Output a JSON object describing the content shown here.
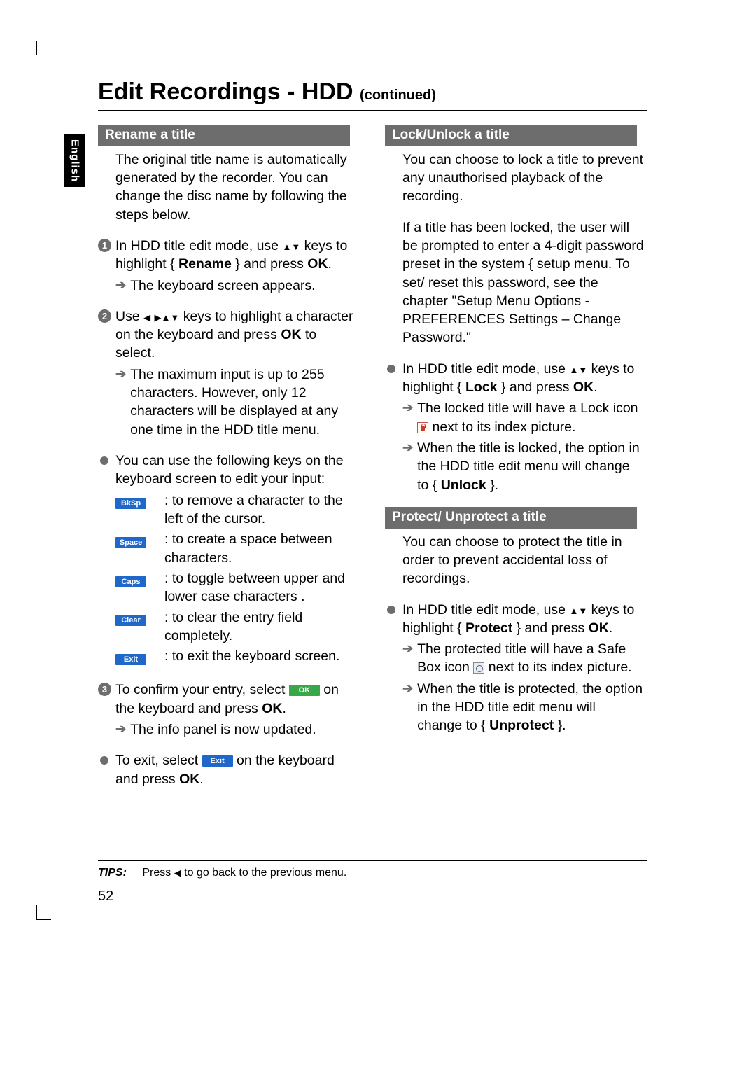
{
  "side_tab": "English",
  "title_main": "Edit Recordings - HDD",
  "title_cont": "(continued)",
  "left": {
    "section": "Rename a title",
    "intro": "The original title name is automatically generated by the recorder. You can change the disc name by following the steps below.",
    "step1_a": "In HDD title edit mode, use ",
    "step1_b": " keys to highlight { ",
    "step1_bold": "Rename",
    "step1_c": " } and press ",
    "step1_ok": "OK",
    "step1_d": ".",
    "step1_res": "The keyboard screen appears.",
    "step2_a": "Use ",
    "step2_b": " keys to highlight a character on the keyboard and press ",
    "step2_ok": "OK",
    "step2_c": " to select.",
    "step2_res": "The maximum input is up to 255 characters. However, only 12 characters will be displayed at any one time in the HDD title menu.",
    "bullet_use": "You can use the following keys on the keyboard screen to edit your input:",
    "keys": [
      {
        "cap": "BkSp",
        "desc": ": to remove a character to the left of the cursor."
      },
      {
        "cap": "Space",
        "desc": ": to create a space between characters."
      },
      {
        "cap": "Caps",
        "desc": ": to toggle between upper and lower case characters ."
      },
      {
        "cap": "Clear",
        "desc": ": to clear the entry field completely."
      },
      {
        "cap": "Exit",
        "desc": ": to exit the keyboard screen."
      }
    ],
    "step3_a": "To confirm your entry, select ",
    "step3_okcap": "OK",
    "step3_b": " on the keyboard and press ",
    "step3_ok": "OK",
    "step3_c": ".",
    "step3_res": "The info panel is now updated.",
    "exit_a": "To exit, select ",
    "exit_cap": "Exit",
    "exit_b": " on the keyboard and press ",
    "exit_ok": "OK",
    "exit_c": "."
  },
  "right": {
    "section1": "Lock/Unlock a title",
    "p1": "You can choose to lock a title to prevent any unauthorised playback of the recording.",
    "p2": "If a title has been locked, the user will be prompted to enter a 4-digit password preset in the system { setup menu. To set/ reset this password, see the chapter \"Setup Menu Options - PREFERENCES Settings – Change Password.\"",
    "lock_a": "In HDD title edit mode, use ",
    "lock_b": " keys to highlight { ",
    "lock_bold": "Lock",
    "lock_c": " } and press ",
    "lock_ok": "OK",
    "lock_d": ".",
    "lock_res1": "The locked title will have a Lock icon ",
    "lock_res1b": " next to its index picture.",
    "lock_res2a": "When the title is locked, the option in the HDD title edit menu will change to { ",
    "lock_res2bold": "Unlock",
    "lock_res2b": " }.",
    "section2": "Protect/ Unprotect a title",
    "p3": "You can choose to protect the title in order to prevent accidental loss of recordings.",
    "prot_a": "In HDD title edit mode, use ",
    "prot_b": " keys to highlight { ",
    "prot_bold": "Protect",
    "prot_c": " } and press ",
    "prot_ok": "OK",
    "prot_d": ".",
    "prot_res1a": "The protected title will have a Safe Box icon ",
    "prot_res1b": " next to its index picture.",
    "prot_res2a": "When the title is protected, the option in the HDD title edit menu will change to { ",
    "prot_res2bold": "Unprotect",
    "prot_res2b": " }."
  },
  "tips_label": "TIPS:",
  "tips_text_a": "Press ",
  "tips_text_b": " to go back to the previous menu.",
  "page_number": "52"
}
